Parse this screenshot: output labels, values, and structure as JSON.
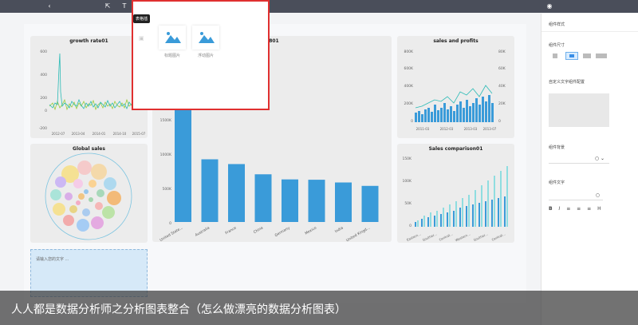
{
  "toolbar": {
    "active_tooltip": "表格插"
  },
  "popup": {
    "items": [
      {
        "label": "标题图片"
      },
      {
        "label": "浮动图片"
      }
    ]
  },
  "charts": {
    "growth": {
      "title": "growth rate01",
      "y_ticks": [
        "600",
        "400",
        "200",
        "0",
        "-200"
      ],
      "x_ticks": [
        "2012-07",
        "2013-04",
        "2014-01",
        "2014-10",
        "2015-07"
      ]
    },
    "country": {
      "title_suffix": "o 801",
      "y_ticks": [
        "1500K",
        "1000K",
        "500K",
        "0"
      ]
    },
    "profits": {
      "title": "sales and profits",
      "y_left": [
        "800K",
        "600K",
        "400K",
        "200K",
        "0"
      ],
      "y_right": [
        "80K",
        "60K",
        "40K",
        "20K",
        "0"
      ],
      "x_ticks": [
        "2011-03",
        "2012-03",
        "2013-03",
        "2013-07"
      ]
    },
    "global": {
      "title": "Global sales"
    },
    "comparison": {
      "title": "Sales comparison01",
      "y_ticks": [
        "150K",
        "100K",
        "50K",
        "0"
      ],
      "x_ticks": [
        "Eastern...",
        "Souther...",
        "Central...",
        "Western...",
        "Souther...",
        "Central..."
      ]
    }
  },
  "chart_data": [
    {
      "type": "bar",
      "title": "",
      "categories": [
        "United State...",
        "Australia",
        "France",
        "China",
        "Germany",
        "Mexico",
        "India",
        "United Kingd..."
      ],
      "values": [
        1650,
        920,
        850,
        700,
        625,
        620,
        580,
        530
      ],
      "ylim": [
        0,
        1500
      ]
    }
  ],
  "textbox": {
    "placeholder": "请输入您的文字 ..."
  },
  "panel": {
    "section1": "组件样式",
    "size_label": "组件尺寸",
    "custom_label": "自定义文字组件配置",
    "bg_label": "组件背景",
    "text_label": "组件文字",
    "format_buttons": [
      "B",
      "I",
      "≡",
      "≡",
      "≡",
      "H"
    ]
  },
  "banner": {
    "text": "人人都是数据分析师之分析图表整合（怎么做漂亮的数据分析图表）"
  },
  "colors": {
    "bar": "#3a9bd9",
    "teal": "#2bbbb6",
    "accent": "#e03030"
  }
}
